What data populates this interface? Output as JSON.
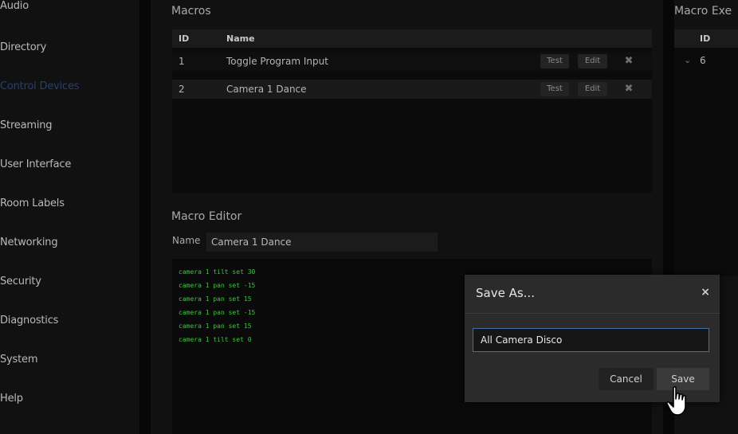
{
  "sidebar": {
    "items": [
      {
        "label": "Audio",
        "active": false
      },
      {
        "label": "Directory",
        "active": false
      },
      {
        "label": "Control Devices",
        "active": true
      },
      {
        "label": "Streaming",
        "active": false
      },
      {
        "label": "User Interface",
        "active": false
      },
      {
        "label": "Room Labels",
        "active": false
      },
      {
        "label": "Networking",
        "active": false
      },
      {
        "label": "Security",
        "active": false
      },
      {
        "label": "Diagnostics",
        "active": false
      },
      {
        "label": "System",
        "active": false
      },
      {
        "label": "Help",
        "active": false
      }
    ],
    "active_color": "#27406e"
  },
  "macros": {
    "title": "Macros",
    "columns": {
      "id": "ID",
      "name": "Name"
    },
    "rows": [
      {
        "id": "1",
        "name": "Toggle Program Input",
        "test": "Test",
        "edit": "Edit",
        "delete": "✖"
      },
      {
        "id": "2",
        "name": "Camera 1 Dance",
        "test": "Test",
        "edit": "Edit",
        "delete": "✖"
      }
    ]
  },
  "editor": {
    "title": "Macro Editor",
    "name_label": "Name",
    "name_value": "Camera 1 Dance",
    "code_lines": [
      "camera 1 tilt set 30",
      "camera 1 pan set -15",
      "camera 1 pan set 15",
      "camera 1 pan set -15",
      "camera 1 pan set 15",
      "camera 1 tilt set 0"
    ],
    "code_color": "#3fc43f"
  },
  "execution": {
    "title": "Macro Exe",
    "column_id": "ID",
    "row_expander": "⌄",
    "row_id": "6"
  },
  "dialog": {
    "title": "Save As...",
    "close": "×",
    "input_value": "All Camera Disco",
    "cancel_label": "Cancel",
    "save_label": "Save",
    "focus_color": "#3f6fa8"
  },
  "icons": {
    "cursor": "hand-pointer-icon",
    "delete": "close-icon"
  }
}
